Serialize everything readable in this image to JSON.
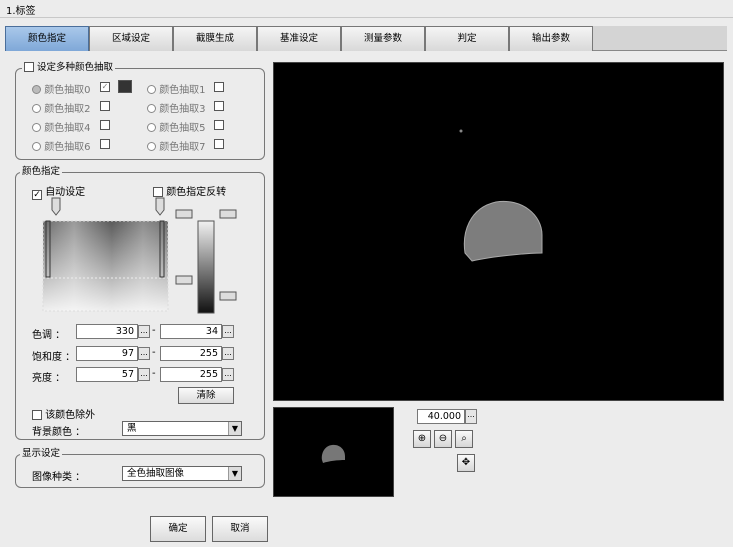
{
  "window": {
    "title": "1.标签"
  },
  "tabs": [
    "颜色指定",
    "区域设定",
    "截膜生成",
    "基准设定",
    "测量参数",
    "判定",
    "输出参数"
  ],
  "multi_color": {
    "group_label": "设定多种颜色抽取",
    "items": [
      "颜色抽取0",
      "颜色抽取1",
      "颜色抽取2",
      "颜色抽取3",
      "颜色抽取4",
      "颜色抽取5",
      "颜色抽取6",
      "颜色抽取7"
    ]
  },
  "color_spec": {
    "group_label": "颜色指定",
    "auto_set": "自动设定",
    "invert": "颜色指定反转",
    "hue_label": "色调 ：",
    "hue_min": "330",
    "hue_max": "34",
    "sat_label": "饱和度 ：",
    "sat_min": "97",
    "sat_max": "255",
    "bri_label": "亮度 ：",
    "bri_min": "57",
    "bri_max": "255",
    "range_sep": "-",
    "browse": "...",
    "clear_button": "清除",
    "exclude_label": "该颜色除外",
    "bg_label": "背景颜色 ：",
    "bg_value": "黑"
  },
  "display": {
    "group_label": "显示设定",
    "image_type_label": "图像种类 ：",
    "image_type_value": "全色抽取图像"
  },
  "zoom": {
    "value": "40.000",
    "browse": "..."
  },
  "footer": {
    "ok": "确定",
    "cancel": "取消"
  },
  "icons": {
    "dropdown": "chevron-down-icon",
    "zoom_in": "zoom-in-icon",
    "zoom_out": "zoom-out-icon",
    "zoom_fit": "zoom-fit-icon",
    "zoom_full": "zoom-full-icon"
  }
}
